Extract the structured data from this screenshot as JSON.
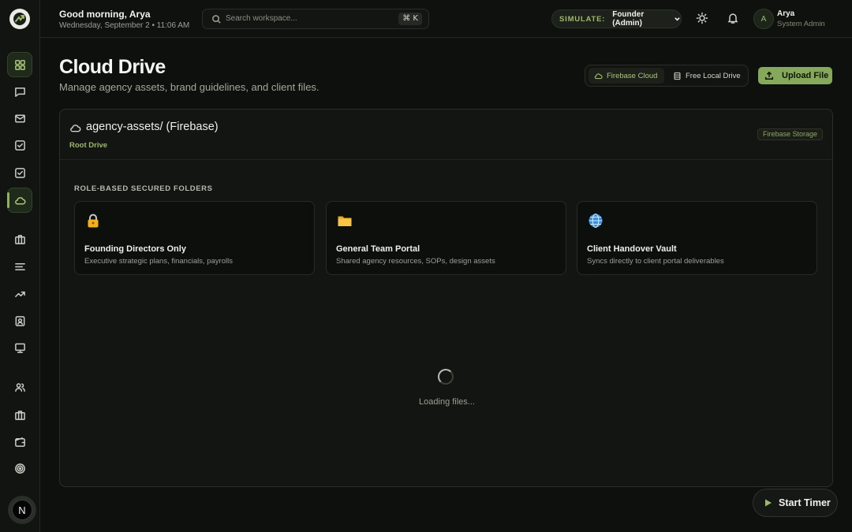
{
  "topbar": {
    "greeting": "Good morning, Arya",
    "date": "Wednesday, September 2 • 11:06 AM",
    "search_placeholder": "Search workspace...",
    "search_shortcut": "⌘ K",
    "simulate_label": "SIMULATE:",
    "simulate_value": "Founder (Admin)",
    "user_initial": "A",
    "user_name": "Arya",
    "user_role": "System Admin"
  },
  "sidebar": {
    "items": [
      {
        "icon": "dashboard-icon",
        "active": false
      },
      {
        "icon": "chat-icon",
        "active": false
      },
      {
        "icon": "mail-icon",
        "active": false
      },
      {
        "icon": "checkbox-icon",
        "active": false
      },
      {
        "icon": "checkbox-icon",
        "active": false
      },
      {
        "icon": "cloud-icon",
        "active": true
      },
      {
        "icon": "briefcase-icon",
        "active": false
      },
      {
        "icon": "list-icon",
        "active": false
      },
      {
        "icon": "trending-icon",
        "active": false
      },
      {
        "icon": "contact-icon",
        "active": false
      },
      {
        "icon": "monitor-icon",
        "active": false
      },
      {
        "icon": "users-icon",
        "active": false
      },
      {
        "icon": "briefcase-icon",
        "active": false
      },
      {
        "icon": "wallet-icon",
        "active": false
      },
      {
        "icon": "target-icon",
        "active": false
      }
    ],
    "user_badge": "N"
  },
  "header": {
    "title": "Cloud Drive",
    "subtitle": "Manage agency assets, brand guidelines, and client files.",
    "toggle_firebase": "Firebase Cloud",
    "toggle_local": "Free Local Drive",
    "upload_label": "Upload File"
  },
  "panel": {
    "path_title": "agency-assets/ (Firebase)",
    "root_label": "Root Drive",
    "storage_badge": "Firebase Storage",
    "section_title": "ROLE-BASED SECURED FOLDERS",
    "folders": [
      {
        "icon": "lock-icon",
        "title": "Founding Directors Only",
        "desc": "Executive strategic plans, financials, payrolls"
      },
      {
        "icon": "folder-icon",
        "title": "General Team Portal",
        "desc": "Shared agency resources, SOPs, design assets"
      },
      {
        "icon": "globe-icon",
        "title": "Client Handover Vault",
        "desc": "Syncs directly to client portal deliverables"
      }
    ],
    "loading_text": "Loading files..."
  },
  "timer": {
    "label": "Start Timer"
  },
  "colors": {
    "accent": "#86a85a",
    "background": "#0e100e",
    "panel": "#131513"
  }
}
